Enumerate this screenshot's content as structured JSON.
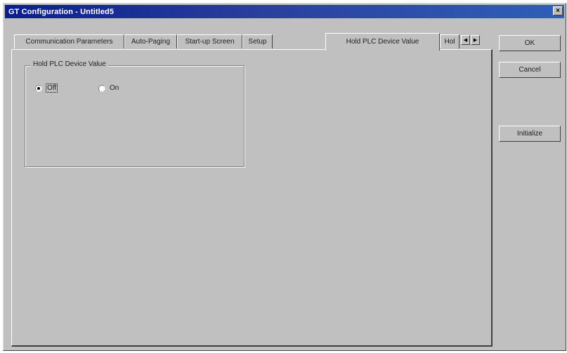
{
  "window": {
    "title": "GT Configuration - Untitled5",
    "close_glyph": "×"
  },
  "tabs": [
    {
      "label": "Communication Parameters",
      "active": false
    },
    {
      "label": "Auto-Paging",
      "active": false
    },
    {
      "label": "Start-up Screen",
      "active": false
    },
    {
      "label": "Setup",
      "active": false
    },
    {
      "label": "Hold PLC Device Value",
      "active": true
    },
    {
      "label": "Hol",
      "active": false
    }
  ],
  "tab_scroll": {
    "left_icon": "arrow-left-icon",
    "right_icon": "arrow-right-icon",
    "left_glyph": "◀",
    "right_glyph": "▶"
  },
  "group": {
    "legend": "Hold PLC Device Value",
    "options": [
      {
        "label": "Off",
        "selected": true
      },
      {
        "label": "On",
        "selected": false
      }
    ]
  },
  "buttons": {
    "ok": "OK",
    "cancel": "Cancel",
    "initialize": "Initialize"
  }
}
